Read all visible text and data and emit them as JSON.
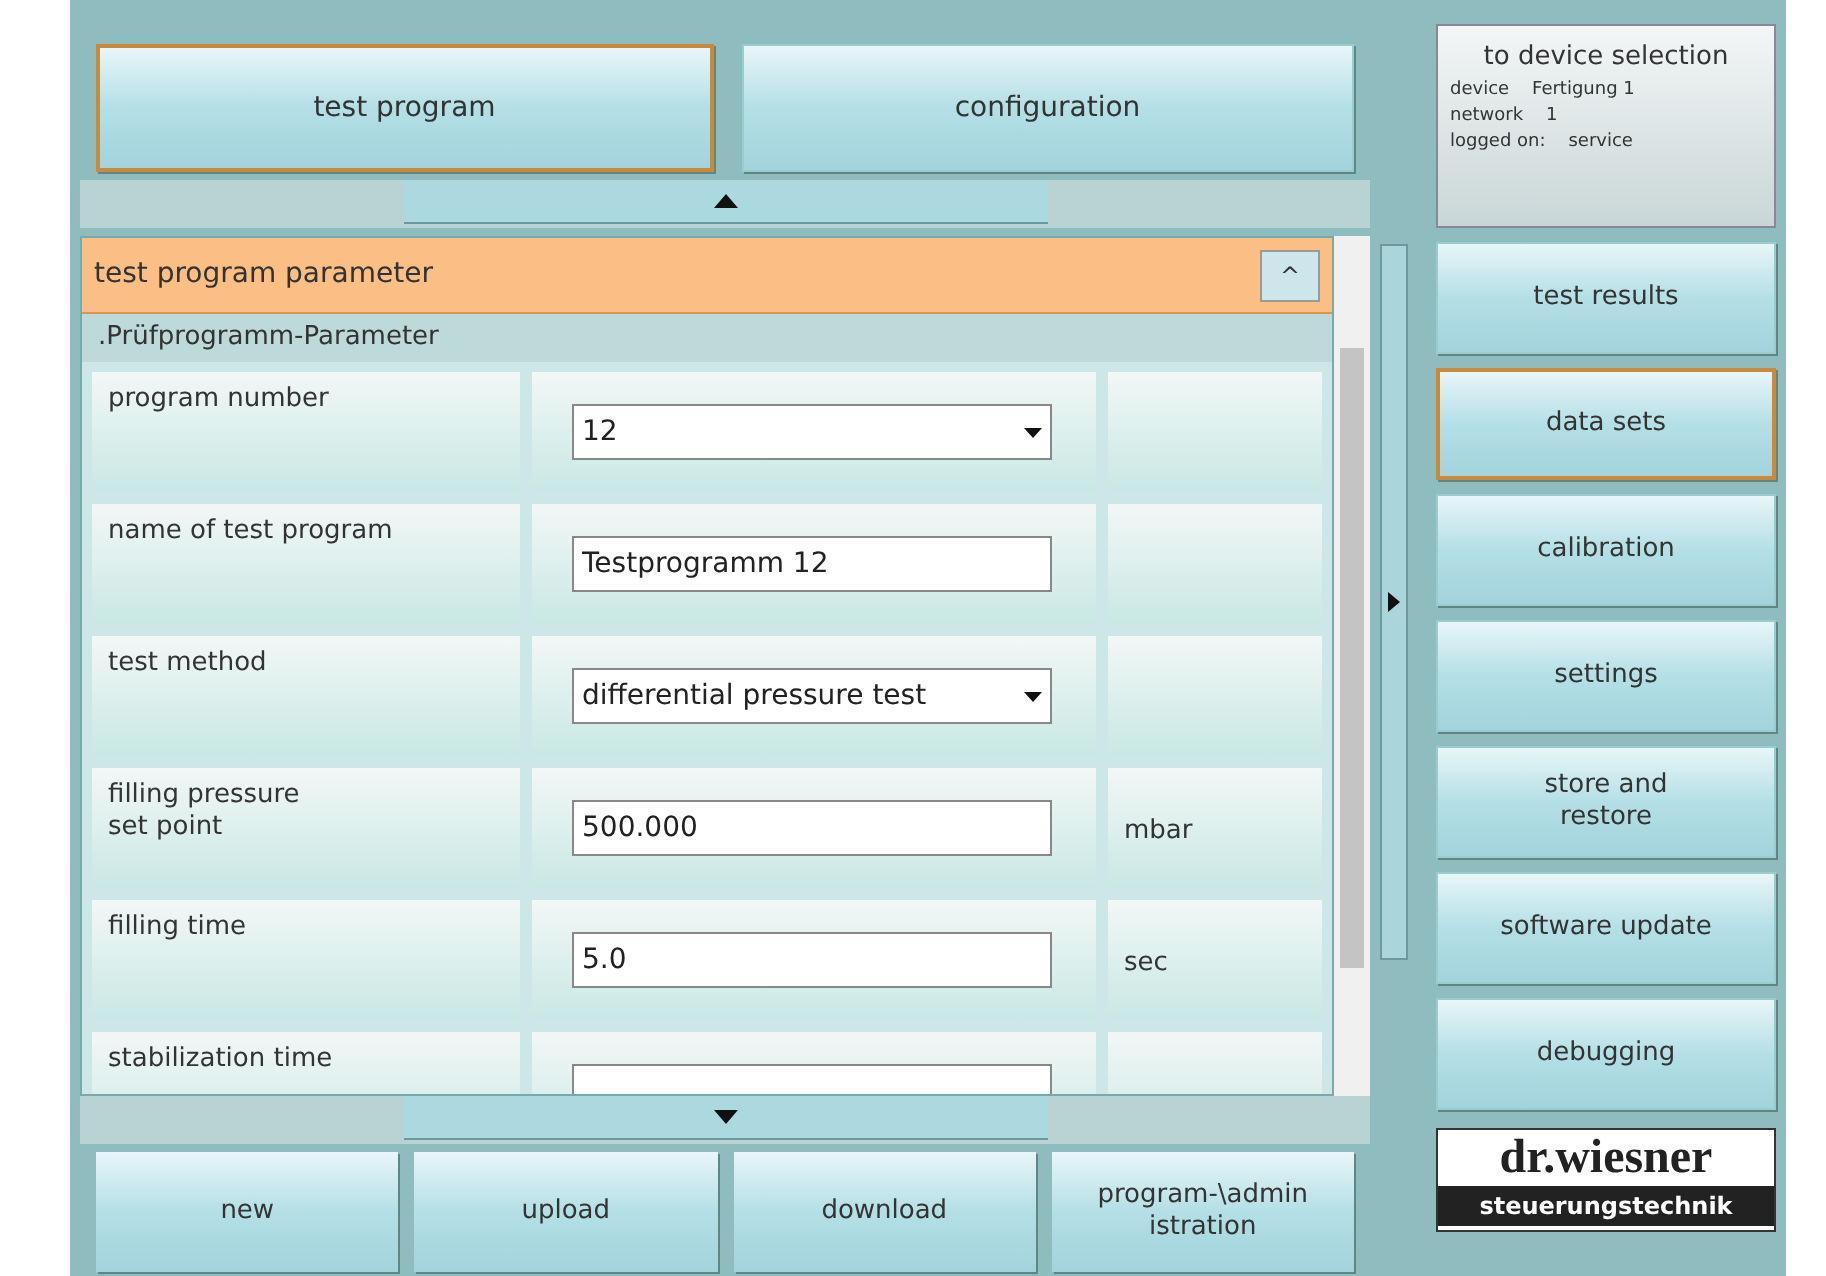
{
  "tabs": [
    {
      "label": "test program",
      "selected": true
    },
    {
      "label": "configuration",
      "selected": false
    }
  ],
  "section": {
    "title": "test program parameter",
    "collapse_button": "^",
    "subtitle": ".Prüfprogramm-Parameter"
  },
  "parameters": [
    {
      "label": "program number",
      "kind": "dropdown",
      "value": "12"
    },
    {
      "label": "name of test program",
      "kind": "text",
      "value": "Testprogramm 12"
    },
    {
      "label": "test method",
      "kind": "dropdown",
      "value": "differential pressure test"
    },
    {
      "label": "filling pressure\nset point",
      "kind": "text",
      "value": "500.000",
      "unit": "mbar"
    },
    {
      "label": "filling time",
      "kind": "text",
      "value": "5.0",
      "unit": "sec"
    },
    {
      "label": "stabilization time",
      "kind": "text"
    }
  ],
  "bottom_buttons": [
    "new",
    "upload",
    "download",
    "program-\\admin\nistration"
  ],
  "device": {
    "title": "to device selection",
    "lines": [
      [
        "device",
        "Fertigung 1"
      ],
      [
        "network",
        "1"
      ],
      [
        "logged on:",
        "service"
      ]
    ]
  },
  "nav": [
    {
      "label": "test results",
      "selected": false
    },
    {
      "label": "data sets",
      "selected": true
    },
    {
      "label": "calibration",
      "selected": false
    },
    {
      "label": "settings",
      "selected": false
    },
    {
      "label": "store and\nrestore",
      "selected": false
    },
    {
      "label": "software update",
      "selected": false
    },
    {
      "label": "debugging",
      "selected": false
    }
  ],
  "logo": {
    "name": "dr.wiesner",
    "tagline": "steuerungstechnik"
  }
}
